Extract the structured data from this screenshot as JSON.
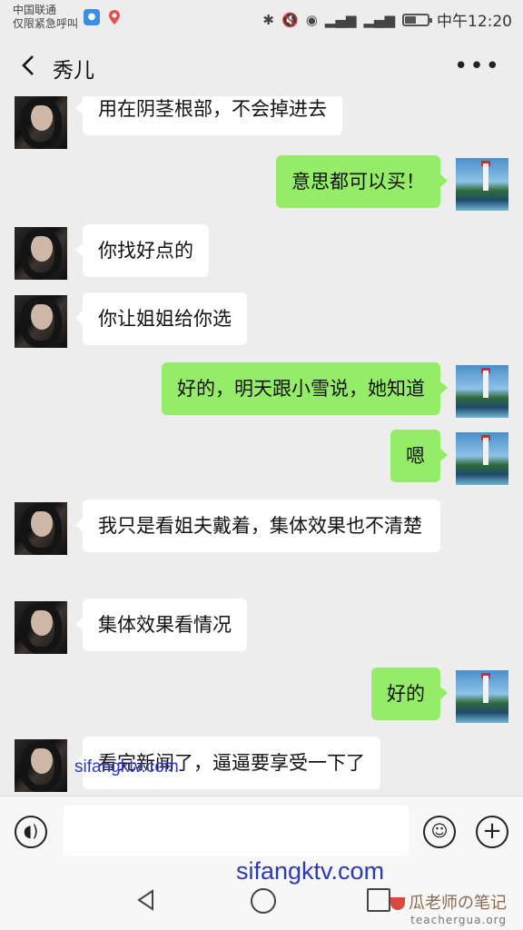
{
  "status_bar": {
    "carrier": "中国联通",
    "carrier_note": "仅限紧急呼叫",
    "time": "中午12:20",
    "battery_level": 0.45,
    "icons": [
      "notification-badge-icon",
      "location-icon",
      "bluetooth-icon",
      "mute-icon",
      "eye-icon",
      "signal-4g-icon",
      "signal-icon",
      "battery-icon"
    ]
  },
  "header": {
    "title": "秀儿",
    "back_icon": "chevron-left-icon",
    "more_icon": "more-dots-icon",
    "more_label": "•••"
  },
  "messages": [
    {
      "side": "left",
      "text": "用在阴茎根部，不会掉进去"
    },
    {
      "side": "right",
      "text": "意思都可以买！"
    },
    {
      "side": "left",
      "text": "你找好点的"
    },
    {
      "side": "left",
      "text": "你让姐姐给你选"
    },
    {
      "side": "right",
      "text": "好的，明天跟小雪说，她知道"
    },
    {
      "side": "right",
      "text": "嗯"
    },
    {
      "side": "left",
      "text": "我只是看姐夫戴着，集体效果也不清楚"
    },
    {
      "side": "left",
      "text": "集体效果看情况"
    },
    {
      "side": "right",
      "text": "好的"
    },
    {
      "side": "left",
      "text": "看完新闻了，逼逼要享受一下了"
    }
  ],
  "watermarks": {
    "overlay_small": "sifangktv.com",
    "overlay_large": "sifangktv.com",
    "brand_name": "瓜老师の笔记",
    "brand_url": "teachergua.org"
  },
  "input_bar": {
    "voice_icon": "voice-icon",
    "emoji_icon": "emoji-icon",
    "plus_icon": "plus-icon",
    "plus_label": "+",
    "placeholder": ""
  },
  "colors": {
    "background": "#ededed",
    "bubble_self": "#95ec69",
    "bubble_other": "#ffffff",
    "watermark": "#2c39b8"
  }
}
